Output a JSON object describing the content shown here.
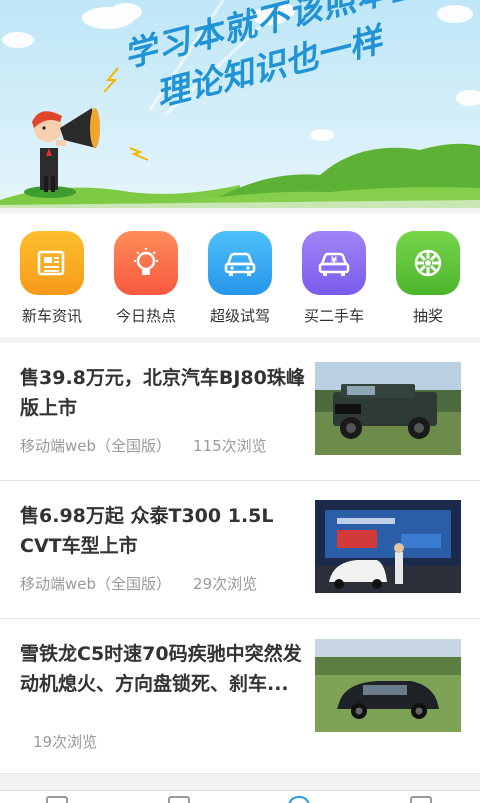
{
  "banner": {
    "line1": "学习本就不该照本宣科",
    "line2": "理论知识也一样"
  },
  "categories": [
    {
      "label": "新车资讯",
      "icon": "newspaper-icon",
      "color": "#f7a41c"
    },
    {
      "label": "今日热点",
      "icon": "lightbulb-icon",
      "color": "#fb6f4e"
    },
    {
      "label": "超级试驾",
      "icon": "car-icon",
      "color": "#33a8f0"
    },
    {
      "label": "买二手车",
      "icon": "yuan-car-icon",
      "color": "#8a6cf2"
    },
    {
      "label": "抽奖",
      "icon": "wheel-icon",
      "color": "#5bc236"
    }
  ],
  "news": [
    {
      "title": "售39.8万元，北京汽车BJ80珠峰版上市",
      "source": "移动端web（全国版）",
      "views": "115次浏览"
    },
    {
      "title": "售6.98万起 众泰T300 1.5L CVT车型上市",
      "source": "移动端web（全国版）",
      "views": "29次浏览"
    },
    {
      "title": "雪铁龙C5时速70码疾驰中突然发动机熄火、方向盘锁死、刹车...",
      "source": "",
      "views": "19次浏览"
    }
  ]
}
